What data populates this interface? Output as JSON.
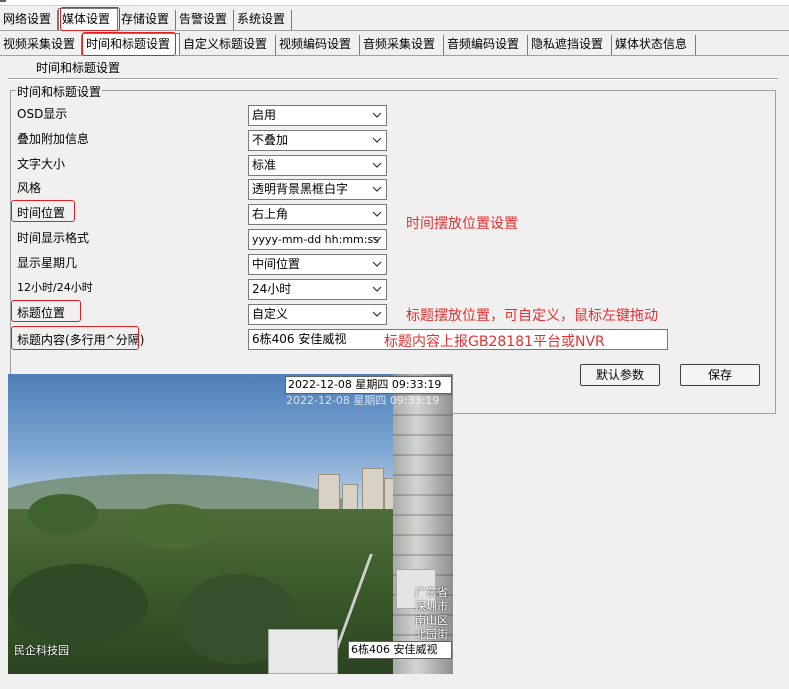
{
  "main_tabs": [
    "网络设置",
    "媒体设置",
    "存储设置",
    "告警设置",
    "系统设置"
  ],
  "sub_tabs": [
    "视频采集设置",
    "时间和标题设置",
    "自定义标题设置",
    "视频编码设置",
    "音频采集设置",
    "音频编码设置",
    "隐私遮挡设置",
    "媒体状态信息"
  ],
  "page": {
    "section_title": "时间和标题设置",
    "group_title": "时间和标题设置"
  },
  "settings": [
    {
      "label": "OSD显示",
      "value": "启用"
    },
    {
      "label": "叠加附加信息",
      "value": "不叠加"
    },
    {
      "label": "文字大小",
      "value": "标准"
    },
    {
      "label": "风格",
      "value": "透明背景黑框白字"
    },
    {
      "label": "时间位置",
      "value": "右上角"
    },
    {
      "label": "时间显示格式",
      "value": "yyyy-mm-dd hh:mm:ss"
    },
    {
      "label": "显示星期几",
      "value": "中间位置"
    },
    {
      "label": "12小时/24小时",
      "value": "24小时"
    },
    {
      "label": "标题位置",
      "value": "自定义"
    }
  ],
  "title_content": {
    "label": "标题内容(多行用^分隔)",
    "value": "6栋406 安佳威视"
  },
  "annotations": {
    "time_position": "时间摆放位置设置",
    "title_position": "标题摆放位置，可自定义，鼠标左键拖动",
    "title_content": "标题内容上报GB28181平台或NVR"
  },
  "buttons": {
    "default": "默认参数",
    "save": "保存"
  },
  "preview": {
    "osd_time": "2022-12-08 星期四 09:33:19",
    "osd_time_ghost": "2022-12-08 星期四 09:33:19",
    "osd_title": "6栋406 安佳威视",
    "address_lines": [
      "广东省",
      "深圳市",
      "南山区",
      "北园街道"
    ],
    "corner_text": "民企科技园"
  },
  "colors": {
    "annotation": "#e53030",
    "highlight_box": "#e02020"
  }
}
